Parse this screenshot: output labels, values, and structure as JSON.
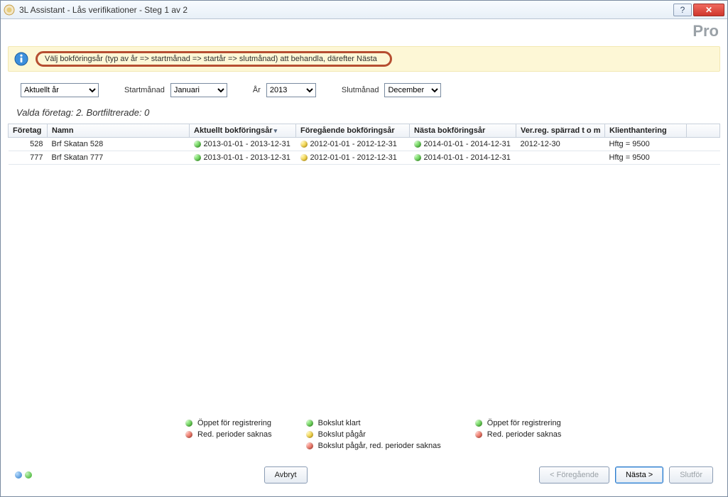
{
  "window": {
    "title": "3L Assistant - Lås verifikationer - Steg 1 av 2"
  },
  "logo_text": "Pro",
  "info": {
    "message": "Välj bokföringsår (typ av år => startmånad => startår => slutmånad) att behandla, därefter Nästa"
  },
  "filters": {
    "year_type": {
      "label": "",
      "value": "Aktuellt år"
    },
    "start_month": {
      "label": "Startmånad",
      "value": "Januari"
    },
    "year": {
      "label": "År",
      "value": "2013"
    },
    "end_month": {
      "label": "Slutmånad",
      "value": "December"
    }
  },
  "status_line": "Valda företag: 2. Bortfiltrerade: 0",
  "columns": {
    "foretag": "Företag",
    "namn": "Namn",
    "aktuellt": "Aktuellt bokföringsår",
    "foregaende": "Föregående bokföringsår",
    "nasta": "Nästa bokföringsår",
    "verreg": "Ver.reg. spärrad t o m",
    "klient": "Klienthantering"
  },
  "rows": [
    {
      "foretag": "528",
      "namn": "Brf Skatan 528",
      "aktuellt": {
        "status": "green",
        "text": "2013-01-01 - 2013-12-31"
      },
      "foregaende": {
        "status": "yellow",
        "text": "2012-01-01 - 2012-12-31"
      },
      "nasta": {
        "status": "green",
        "text": "2014-01-01 - 2014-12-31"
      },
      "verreg": "2012-12-30",
      "klient": "Hftg = 9500"
    },
    {
      "foretag": "777",
      "namn": "Brf Skatan 777",
      "aktuellt": {
        "status": "green",
        "text": "2013-01-01 - 2013-12-31"
      },
      "foregaende": {
        "status": "yellow",
        "text": "2012-01-01 - 2012-12-31"
      },
      "nasta": {
        "status": "green",
        "text": "2014-01-01 - 2014-12-31"
      },
      "verreg": "",
      "klient": "Hftg = 9500"
    }
  ],
  "legend": {
    "col1": [
      {
        "status": "green",
        "text": "Öppet för registrering"
      },
      {
        "status": "red",
        "text": "Red. perioder saknas"
      }
    ],
    "col2": [
      {
        "status": "green",
        "text": "Bokslut klart"
      },
      {
        "status": "yellow",
        "text": "Bokslut pågår"
      },
      {
        "status": "red",
        "text": "Bokslut pågår, red. perioder saknas"
      }
    ],
    "col3": [
      {
        "status": "green",
        "text": "Öppet för registrering"
      },
      {
        "status": "red",
        "text": "Red. perioder saknas"
      }
    ]
  },
  "footer": {
    "cancel": "Avbryt",
    "back": "< Föregående",
    "next": "Nästa >",
    "finish": "Slutför"
  }
}
